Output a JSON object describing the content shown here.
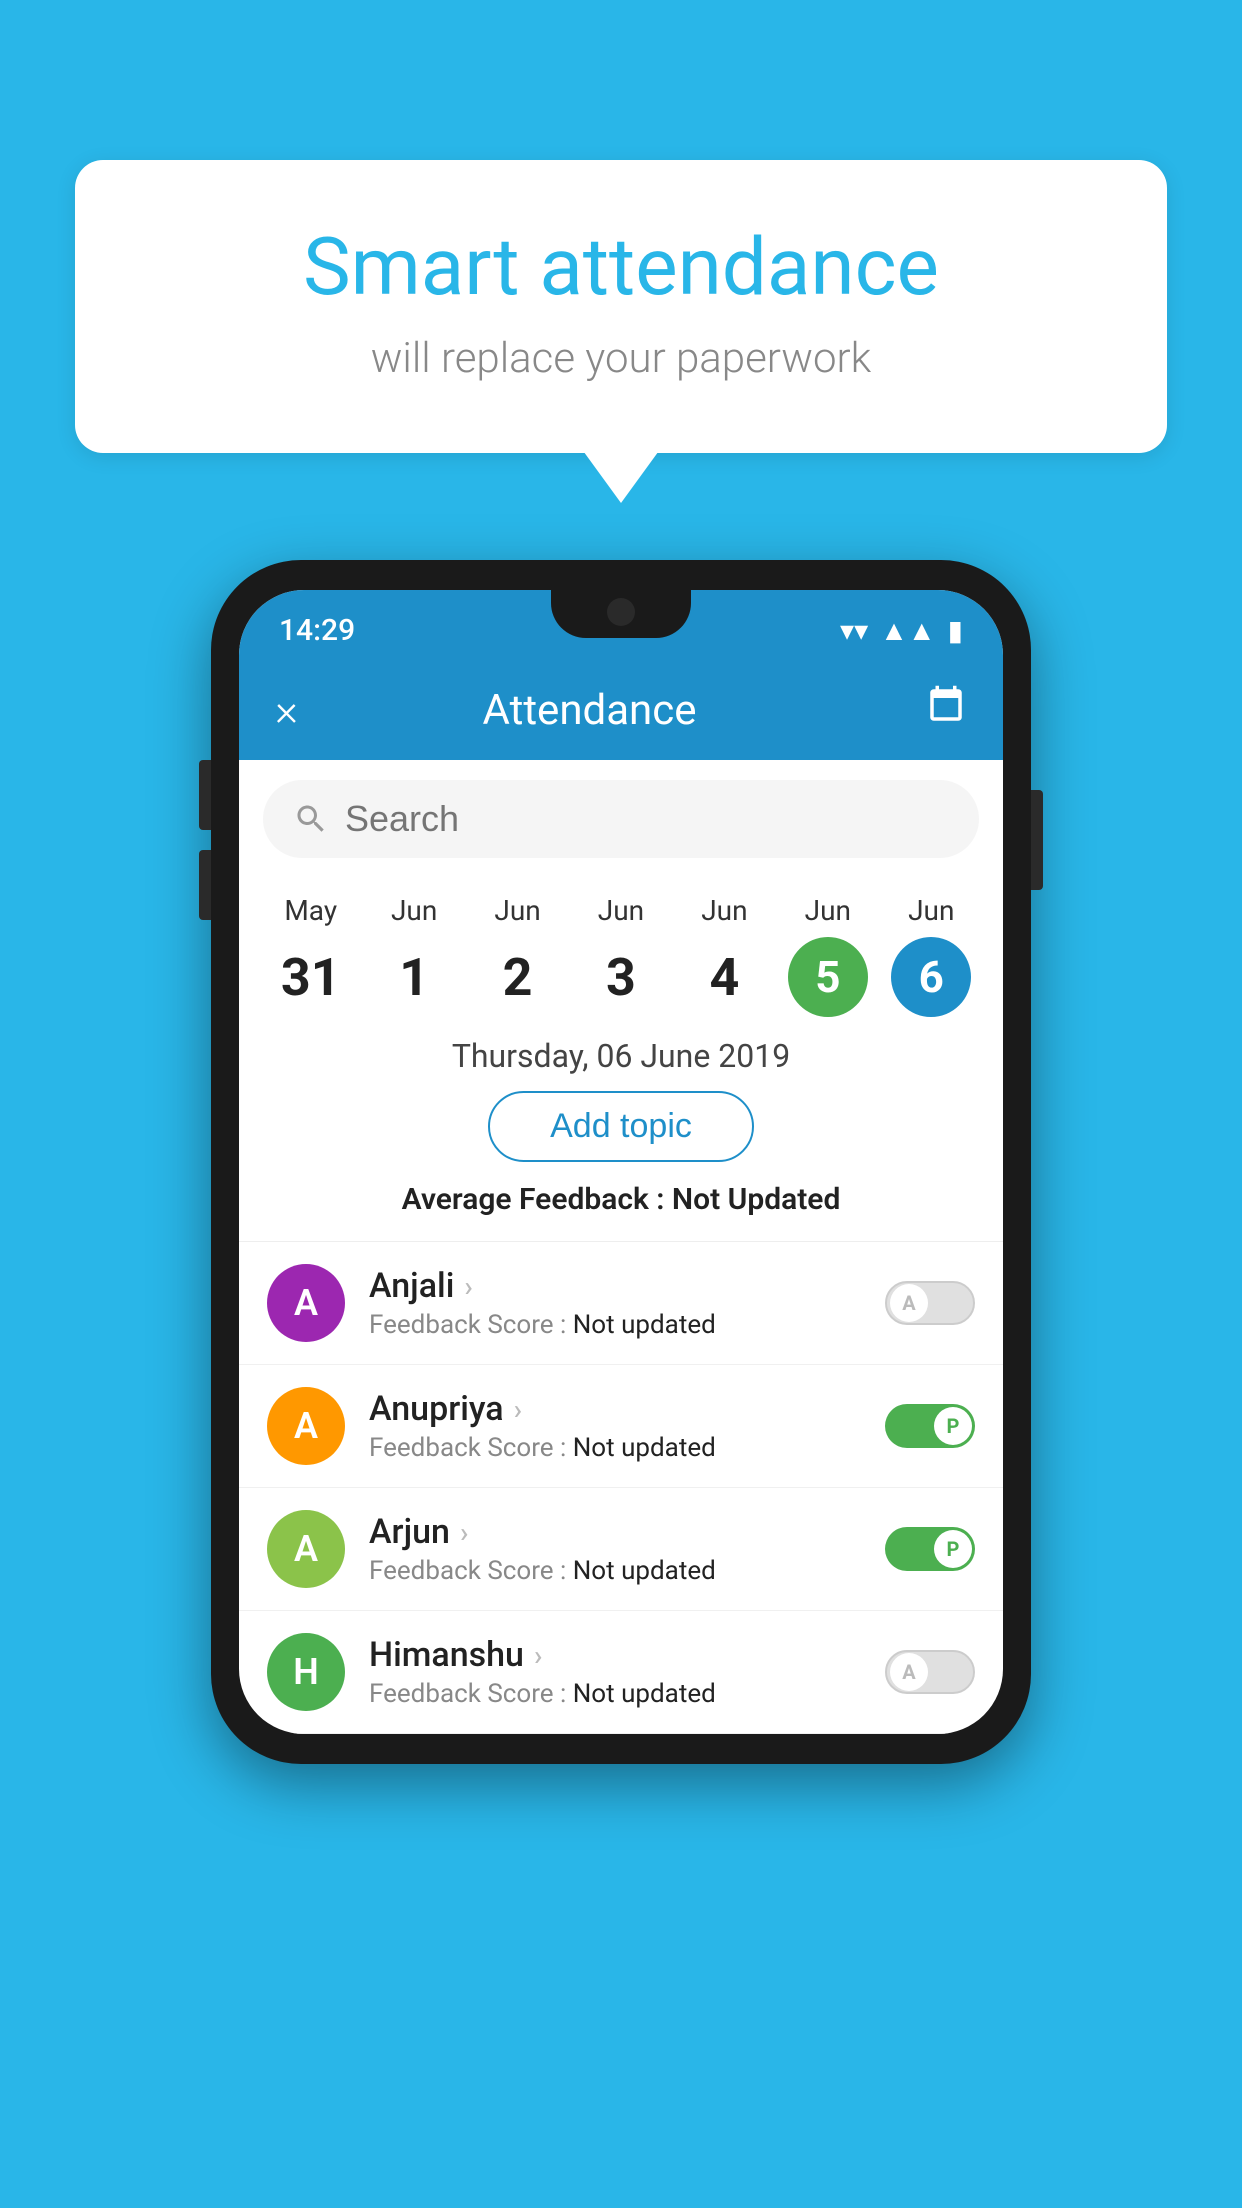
{
  "background_color": "#29b6e8",
  "speech_bubble": {
    "title": "Smart attendance",
    "subtitle": "will replace your paperwork"
  },
  "status_bar": {
    "time": "14:29",
    "icons": [
      "wifi",
      "signal",
      "battery"
    ]
  },
  "header": {
    "title": "Attendance",
    "close_label": "×",
    "calendar_icon": "📅"
  },
  "search": {
    "placeholder": "Search"
  },
  "dates": [
    {
      "month": "May",
      "day": "31",
      "type": "normal"
    },
    {
      "month": "Jun",
      "day": "1",
      "type": "normal"
    },
    {
      "month": "Jun",
      "day": "2",
      "type": "normal"
    },
    {
      "month": "Jun",
      "day": "3",
      "type": "normal"
    },
    {
      "month": "Jun",
      "day": "4",
      "type": "normal"
    },
    {
      "month": "Jun",
      "day": "5",
      "type": "selected-green"
    },
    {
      "month": "Jun",
      "day": "6",
      "type": "selected-blue"
    }
  ],
  "selected_date_label": "Thursday, 06 June 2019",
  "add_topic_label": "Add topic",
  "avg_feedback_label": "Average Feedback :",
  "avg_feedback_value": "Not Updated",
  "students": [
    {
      "name": "Anjali",
      "initial": "A",
      "avatar_color": "purple",
      "feedback_label": "Feedback Score :",
      "feedback_value": "Not updated",
      "toggle": "off",
      "toggle_letter": "A"
    },
    {
      "name": "Anupriya",
      "initial": "A",
      "avatar_color": "orange",
      "feedback_label": "Feedback Score :",
      "feedback_value": "Not updated",
      "toggle": "on",
      "toggle_letter": "P"
    },
    {
      "name": "Arjun",
      "initial": "A",
      "avatar_color": "green",
      "feedback_label": "Feedback Score :",
      "feedback_value": "Not updated",
      "toggle": "on",
      "toggle_letter": "P"
    },
    {
      "name": "Himanshu",
      "initial": "H",
      "avatar_color": "teal",
      "feedback_label": "Feedback Score :",
      "feedback_value": "Not updated",
      "toggle": "off",
      "toggle_letter": "A"
    }
  ]
}
